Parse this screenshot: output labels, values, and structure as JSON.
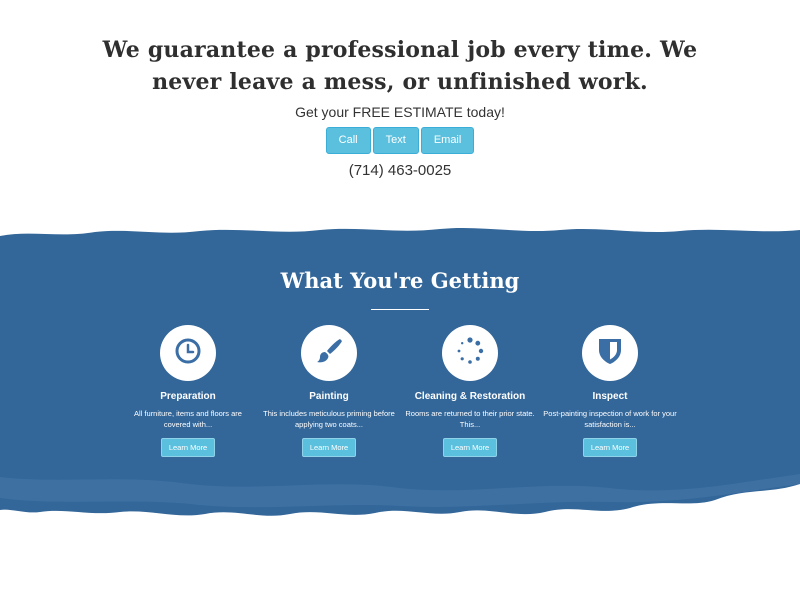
{
  "hero": {
    "headline": "We guarantee a professional job every time. We never leave a mess, or unfinished work.",
    "estimate_text": "Get your FREE ESTIMATE today!",
    "buttons": {
      "call": "Call",
      "text": "Text",
      "email": "Email"
    },
    "phone": "(714) 463-0025"
  },
  "section": {
    "title": "What You're Getting"
  },
  "features": [
    {
      "icon": "clock-icon",
      "title": "Preparation",
      "desc": "All furniture, items and floors are covered with...",
      "button": "Learn More"
    },
    {
      "icon": "paintbrush-icon",
      "title": "Painting",
      "desc": "This includes meticulous priming before applying two coats...",
      "button": "Learn More"
    },
    {
      "icon": "spinner-icon",
      "title": "Cleaning & Restoration",
      "desc": "Rooms are returned to their prior state. This...",
      "button": "Learn More"
    },
    {
      "icon": "shield-icon",
      "title": "Inspect",
      "desc": "Post-painting inspection of work for your satisfaction is...",
      "button": "Learn More"
    }
  ],
  "colors": {
    "band": "#336699",
    "accent_button": "#5bc0de",
    "icon": "#3a6ea5"
  }
}
